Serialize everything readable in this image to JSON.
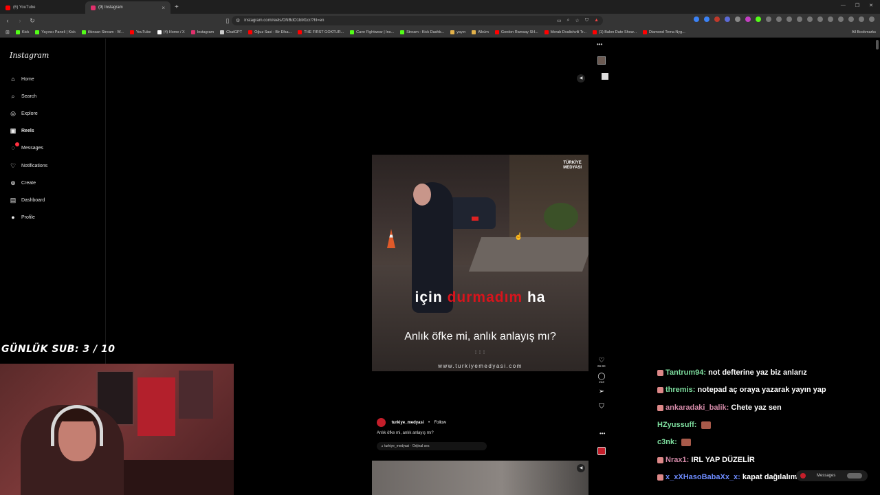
{
  "browser": {
    "tabs": [
      {
        "title": "(6) YouTube",
        "color": "#ff0000"
      },
      {
        "title": "(9) Instagram",
        "color": "#e1306c"
      }
    ],
    "url": "instagram.com/reels/DNBdO1bM1cr/?hl=en",
    "bookmarks": [
      {
        "label": "Kick",
        "color": "#53fc18"
      },
      {
        "label": "Yayıncı Paneli | Kick",
        "color": "#53fc18"
      },
      {
        "label": "ilkinsan Stream - W...",
        "color": "#53fc18"
      },
      {
        "label": "YouTube",
        "color": "#ff0000"
      },
      {
        "label": "(4) Home / X",
        "color": "#ffffff"
      },
      {
        "label": "Instagram",
        "color": "#e1306c"
      },
      {
        "label": "ChatGPT",
        "color": "#cccccc"
      },
      {
        "label": "Oğuz Sasi - Bir Efsa...",
        "color": "#ff0000"
      },
      {
        "label": "THE FIRST GOKTUR...",
        "color": "#ff0000"
      },
      {
        "label": "Cave Fightwear | Ins...",
        "color": "#53fc18"
      },
      {
        "label": "Stream - Kick Dashb...",
        "color": "#53fc18"
      },
      {
        "label": "yayın",
        "color": "#e2b14a"
      },
      {
        "label": "Albüm",
        "color": "#e2b14a"
      },
      {
        "label": "Gordon Ramsay SH...",
        "color": "#ff0000"
      },
      {
        "label": "Merab Dvalishvili Tr...",
        "color": "#ff0000"
      },
      {
        "label": "(1) Balon Date Show...",
        "color": "#ff0000"
      },
      {
        "label": "Diamond Tema Nyg...",
        "color": "#ff0000"
      }
    ],
    "all_bookmarks": "All Bookmarks"
  },
  "instagram": {
    "logo": "Instagram",
    "nav": [
      {
        "label": "Home",
        "icon": "home-icon",
        "glyph": "⌂"
      },
      {
        "label": "Search",
        "icon": "search-icon",
        "glyph": "⌕"
      },
      {
        "label": "Explore",
        "icon": "explore-icon",
        "glyph": "◎"
      },
      {
        "label": "Reels",
        "icon": "reels-icon",
        "glyph": "▣"
      },
      {
        "label": "Messages",
        "icon": "messages-icon",
        "glyph": "◌"
      },
      {
        "label": "Notifications",
        "icon": "heart-icon",
        "glyph": "♡"
      },
      {
        "label": "Create",
        "icon": "plus-icon",
        "glyph": "⊕"
      },
      {
        "label": "Dashboard",
        "icon": "dashboard-icon",
        "glyph": "▤"
      },
      {
        "label": "Profile",
        "icon": "profile-icon",
        "glyph": "●"
      }
    ],
    "reel": {
      "watermark_line1": "TÜRKİYE",
      "watermark_line2": "MEDYASI",
      "karaoke_white1": "için",
      "karaoke_red": "durmadım",
      "karaoke_white2": "ha",
      "question": "Anlık öfke mi, anlık anlayış mı?",
      "site": "www.turkiyemedyasi.com",
      "likes": "66.9K",
      "comments": "213",
      "username": "turkiye_medyasi",
      "follow": "Follow",
      "separator": "•",
      "caption": "Anlık öfke mi, anlık anlayış mı?",
      "audio": "turkiye_medyasi · Orijinal ses"
    }
  },
  "stream": {
    "sub_goal": "GÜNLÜK SUB: 3 / 10",
    "chat": [
      {
        "user": "Tantrum94:",
        "message": "not defterine yaz biz anlarız",
        "color": "#7fe0a0",
        "emote": ""
      },
      {
        "user": "thremis:",
        "message": "notepad aç oraya yazarak yayın yap",
        "color": "#7fe0a0",
        "emote": ""
      },
      {
        "user": "ankaradaki_balik:",
        "message": "Chete yaz sen",
        "color": "#d48aa8",
        "emote": ""
      },
      {
        "user": "HZyussuff:",
        "message": "",
        "color": "#7fe0a0",
        "emote": "emote"
      },
      {
        "user": "c3nk:",
        "message": "",
        "color": "#7fe0a0",
        "emote": "emote"
      },
      {
        "user": "Nrax1:",
        "message": "IRL YAP DÜZELİR",
        "color": "#d48aa8",
        "emote": ""
      },
      {
        "user": "x_xXHasoBabaXx_x:",
        "message": "kapat dağılalım",
        "color": "#6e8cff",
        "emote": ""
      }
    ]
  },
  "messages_pill": "Messages"
}
